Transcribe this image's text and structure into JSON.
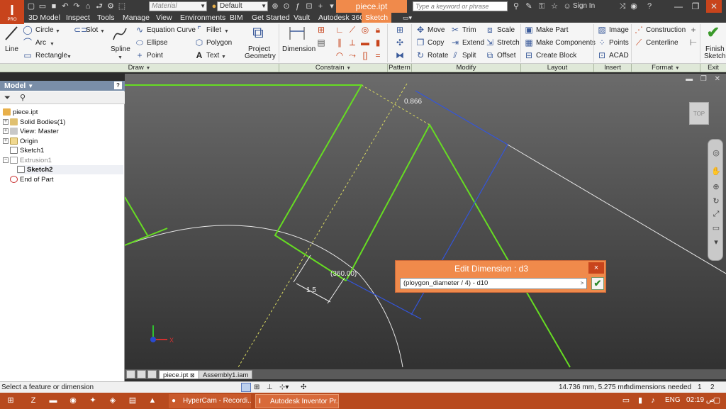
{
  "titlebar": {
    "app_logo": "I",
    "app_logo_sub": "PRO",
    "material_combo": "Material",
    "appearance_combo": "Default",
    "document_title": "piece.ipt",
    "search_placeholder": "Type a keyword or phrase",
    "signin_label": "Sign In"
  },
  "tabs": [
    "3D Model",
    "Inspect",
    "Tools",
    "Manage",
    "View",
    "Environments",
    "BIM",
    "Get Started",
    "Vault",
    "Autodesk 360",
    "Sketch"
  ],
  "ribbon": {
    "draw": {
      "line": "Line",
      "circle": "Circle",
      "arc": "Arc",
      "rectangle": "Rectangle",
      "slot": "Slot",
      "spline": "Spline",
      "equation_curve": "Equation Curve",
      "ellipse": "Ellipse",
      "point": "Point",
      "fillet": "Fillet",
      "polygon": "Polygon",
      "text": "Text",
      "project_geometry_1": "Project",
      "project_geometry_2": "Geometry"
    },
    "constrain": {
      "dimension": "Dimension"
    },
    "modify": {
      "move": "Move",
      "copy": "Copy",
      "rotate": "Rotate",
      "trim": "Trim",
      "extend": "Extend",
      "split": "Split",
      "scale": "Scale",
      "stretch": "Stretch",
      "offset": "Offset"
    },
    "layout": {
      "make_part": "Make Part",
      "make_components": "Make Components",
      "create_block": "Create Block"
    },
    "insert": {
      "image": "Image",
      "points": "Points",
      "acad": "ACAD"
    },
    "format": {
      "construction": "Construction",
      "centerline": "Centerline"
    },
    "exit": {
      "finish_1": "Finish",
      "finish_2": "Sketch"
    },
    "panels": [
      "Draw",
      "Constrain",
      "Pattern",
      "Modify",
      "Layout",
      "Insert",
      "Format",
      "Exit"
    ]
  },
  "browser": {
    "header": "Model",
    "tree": [
      "piece.ipt",
      "Solid Bodies(1)",
      "View: Master",
      "Origin",
      "Sketch1",
      "Extrusion1",
      "Sketch2",
      "End of Part"
    ]
  },
  "viewport": {
    "viewcube_label": "TOP",
    "dim_labels": {
      "d_top": "0.866",
      "d_angle": "(360.00)",
      "d_len": "1.5",
      "axis_x": "X"
    }
  },
  "edit_dimension": {
    "title": "Edit Dimension : d3",
    "expression": "(ploygon_diameter / 4) - d10",
    "close": "×",
    "accept": "✔"
  },
  "doc_tabs": [
    "piece.ipt",
    "Assembly1.iam"
  ],
  "statusbar": {
    "prompt": "Select a feature or dimension",
    "coords": "14.736 mm, 5.275 mm",
    "dims_needed": "4 dimensions needed",
    "count1": "1",
    "count2": "2"
  },
  "taskbar": {
    "items": [
      "HyperCam - Recordi...",
      "Autodesk Inventor Pr..."
    ],
    "lang": "ENG",
    "time": "02:19 ص"
  },
  "colors": {
    "accent": "#f08a4b",
    "profile_green": "#66dd22",
    "dim_blue": "#3355dd",
    "construction_yellow": "#d8d860"
  }
}
